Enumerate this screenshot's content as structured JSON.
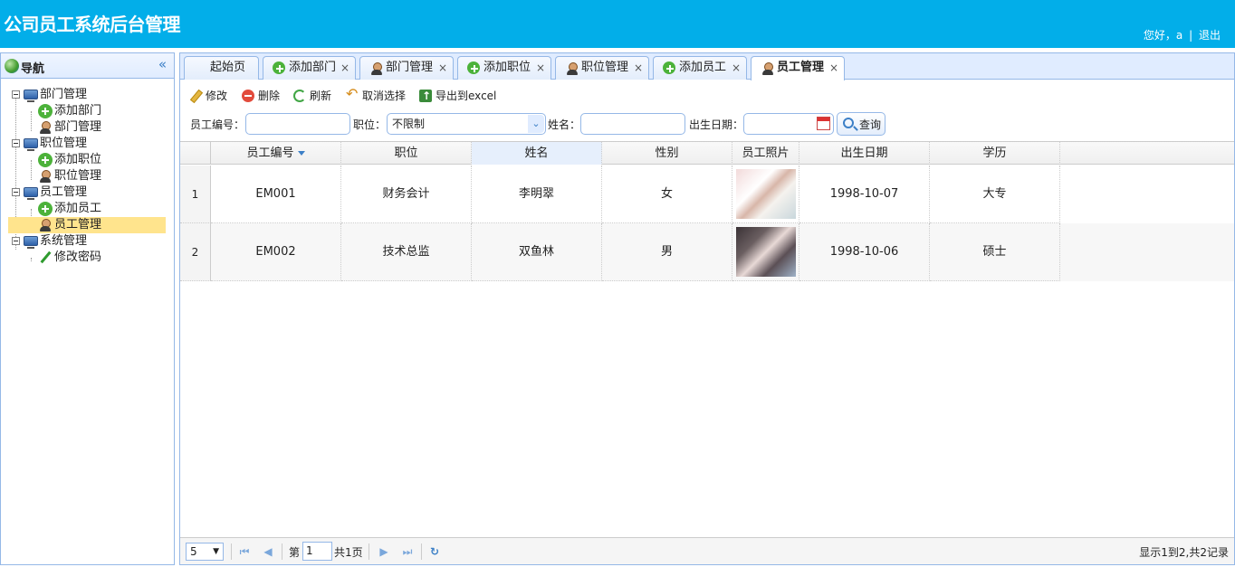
{
  "header": {
    "title": "公司员工系统后台管理",
    "greeting": "您好，a",
    "separator": "|",
    "logout": "退出"
  },
  "nav": {
    "title": "导航",
    "collapse_glyph": "«",
    "groups": [
      {
        "label": "部门管理",
        "children": [
          "添加部门",
          "部门管理"
        ]
      },
      {
        "label": "职位管理",
        "children": [
          "添加职位",
          "职位管理"
        ]
      },
      {
        "label": "员工管理",
        "children": [
          "添加员工",
          "员工管理"
        ]
      },
      {
        "label": "系统管理",
        "children": [
          "修改密码"
        ]
      }
    ],
    "selected": "员工管理"
  },
  "tabs": [
    {
      "label": "起始页",
      "closable": false
    },
    {
      "label": "添加部门",
      "closable": true
    },
    {
      "label": "部门管理",
      "closable": true
    },
    {
      "label": "添加职位",
      "closable": true
    },
    {
      "label": "职位管理",
      "closable": true
    },
    {
      "label": "添加员工",
      "closable": true
    },
    {
      "label": "员工管理",
      "closable": true
    }
  ],
  "tab_close_glyph": "×",
  "toolbar": {
    "edit": "修改",
    "delete": "删除",
    "refresh": "刷新",
    "cancel_select": "取消选择",
    "export": "导出到excel"
  },
  "search": {
    "emp_no_label": "员工编号：",
    "emp_no_value": "",
    "position_label": "职位：",
    "position_value": "不限制",
    "select_arrow": "⌄",
    "name_label": "姓名：",
    "name_value": "",
    "birth_label": "出生日期：",
    "birth_value": "",
    "query_button": "查询"
  },
  "grid": {
    "columns": [
      "员工编号",
      "职位",
      "姓名",
      "性别",
      "员工照片",
      "出生日期",
      "学历"
    ],
    "rows": [
      {
        "num": "1",
        "emp_no": "EM001",
        "position": "财务会计",
        "name": "李明翠",
        "gender": "女",
        "birth": "1998-10-07",
        "education": "大专"
      },
      {
        "num": "2",
        "emp_no": "EM002",
        "position": "技术总监",
        "name": "双鱼林",
        "gender": "男",
        "birth": "1998-10-06",
        "education": "硕士"
      }
    ]
  },
  "pager": {
    "page_size": "5",
    "page_size_arrow": "▼",
    "page_prefix": "第",
    "page_value": "1",
    "page_suffix": "共1页",
    "info": "显示1到2,共2记录",
    "first": "⏮",
    "prev": "◀",
    "next": "▶",
    "last": "⏭",
    "reload": "↻"
  }
}
